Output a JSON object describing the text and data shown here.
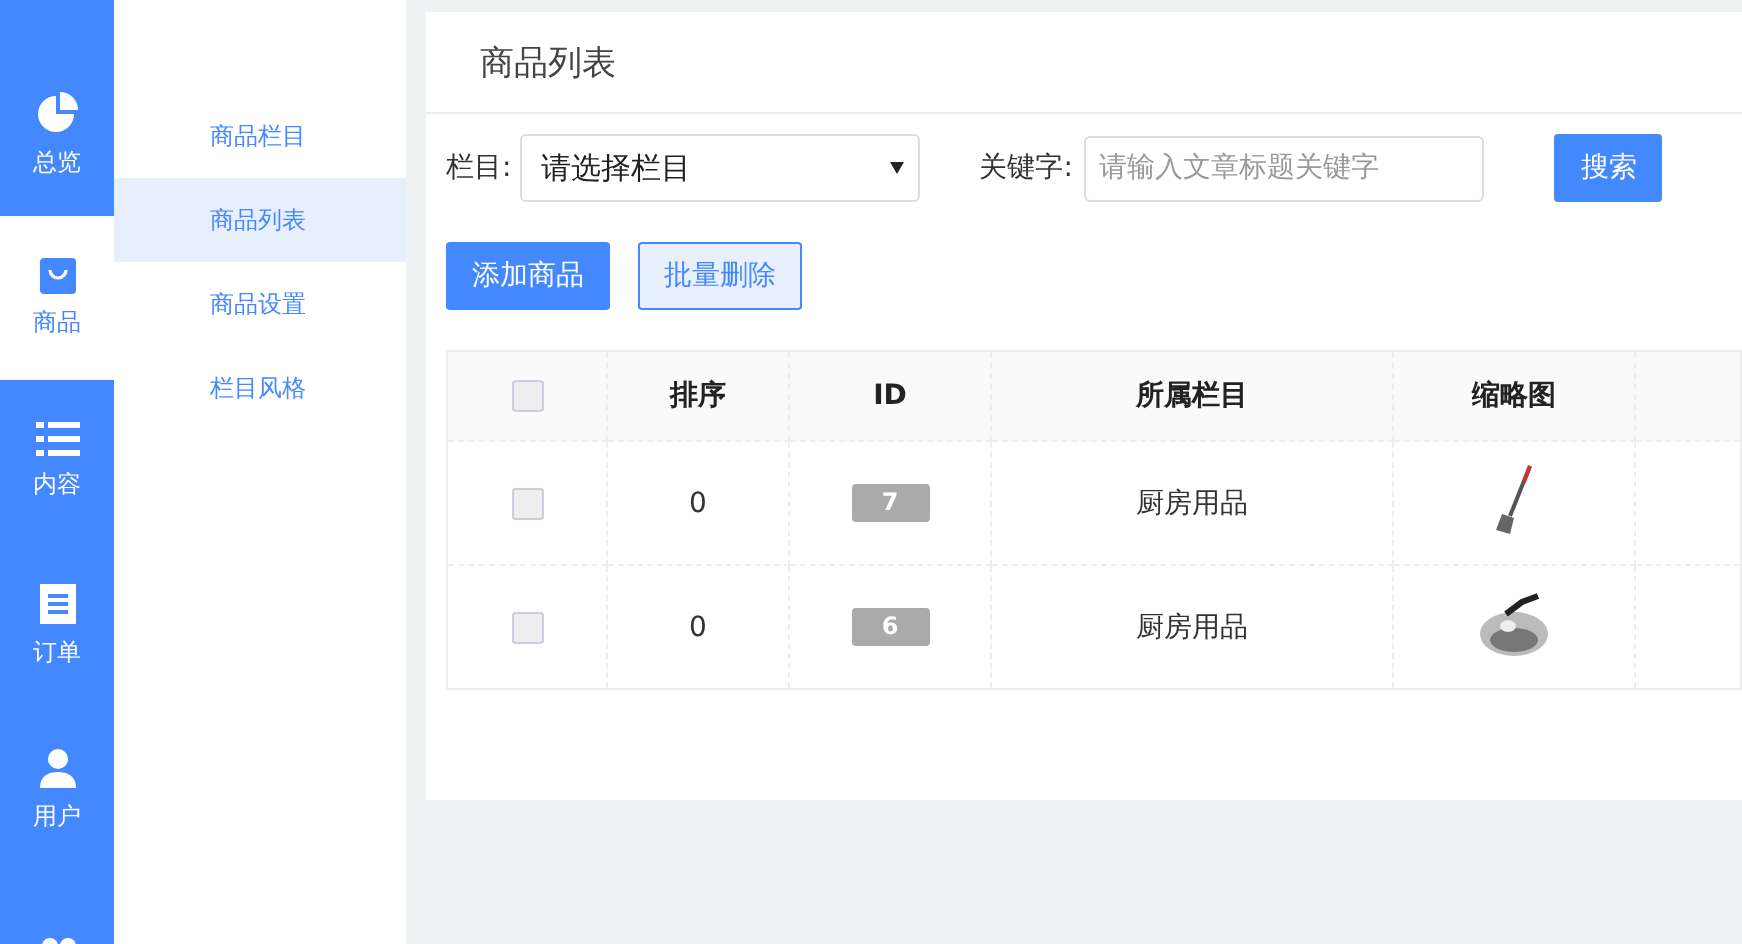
{
  "nav": [
    {
      "label": "总览",
      "selected": false
    },
    {
      "label": "商品",
      "selected": true
    },
    {
      "label": "内容",
      "selected": false
    },
    {
      "label": "订单",
      "selected": false
    },
    {
      "label": "用户",
      "selected": false
    },
    {
      "selected": false
    }
  ],
  "submenu": [
    {
      "label": "商品栏目",
      "selected": false
    },
    {
      "label": "商品列表",
      "selected": true
    },
    {
      "label": "商品设置",
      "selected": false
    },
    {
      "label": "栏目风格",
      "selected": false
    }
  ],
  "panel": {
    "title": "商品列表",
    "filters": {
      "category_label": "栏目:",
      "category_value": "请选择栏目",
      "keyword_label": "关键字:",
      "keyword_placeholder": "请输入文章标题关键字",
      "search_button": "搜索"
    },
    "actions": [
      {
        "kind": "primary",
        "label": "添加商品"
      },
      {
        "kind": "outline",
        "label": "批量删除"
      }
    ],
    "table": {
      "header_checked": false,
      "columns": [
        "排序",
        "ID",
        "所属栏目",
        "缩略图"
      ],
      "rows": [
        {
          "checked": false,
          "sort": "0",
          "id": "7",
          "category": "厨房用品"
        },
        {
          "checked": false,
          "sort": "0",
          "id": "6",
          "category": "厨房用品"
        }
      ]
    }
  }
}
